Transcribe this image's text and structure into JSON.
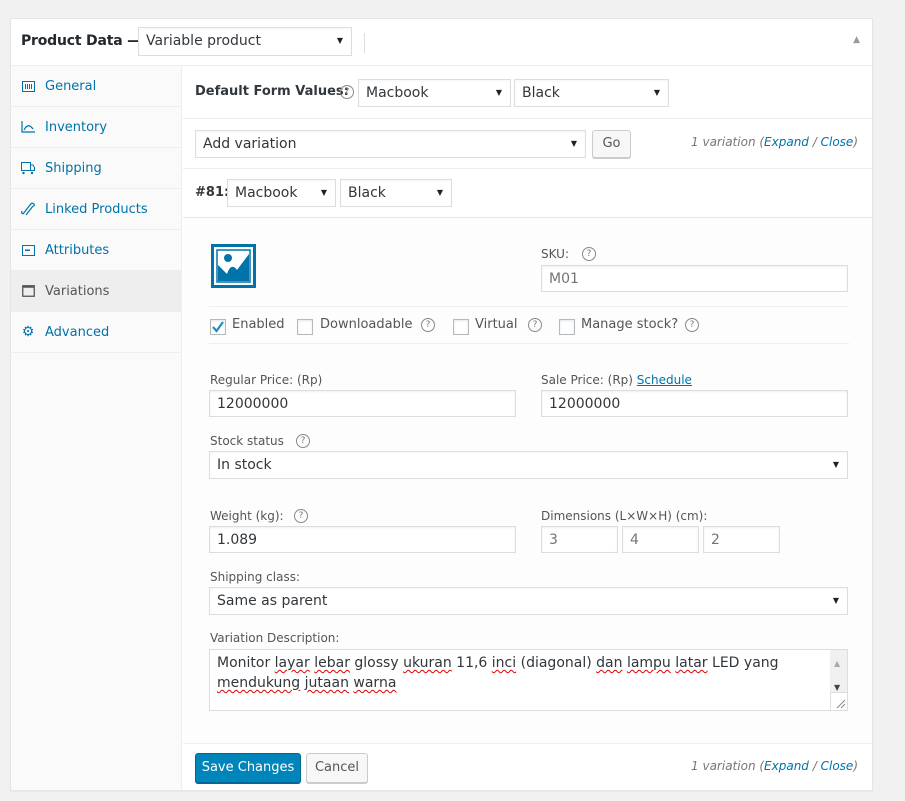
{
  "header": {
    "title": "Product Data —",
    "product_type": "Variable product",
    "collapse_icon": "triangle-up-icon"
  },
  "tabs": [
    {
      "label": "General",
      "icon": "barcode-icon",
      "active": false
    },
    {
      "label": "Inventory",
      "icon": "chart-icon",
      "active": false
    },
    {
      "label": "Shipping",
      "icon": "truck-icon",
      "active": false
    },
    {
      "label": "Linked Products",
      "icon": "link-icon",
      "active": false
    },
    {
      "label": "Attributes",
      "icon": "list-icon",
      "active": false
    },
    {
      "label": "Variations",
      "icon": "window-icon",
      "active": true
    },
    {
      "label": "Advanced",
      "icon": "gear-icon",
      "active": false
    }
  ],
  "default_form": {
    "label": "Default Form Values:",
    "help": "?",
    "attr1": "Macbook",
    "attr2": "Black"
  },
  "add_variation": {
    "select": "Add variation",
    "go_label": "Go",
    "count_text": "1 variation",
    "expand": "Expand",
    "slash": " / ",
    "close": "Close"
  },
  "variation": {
    "id_label": "#81:",
    "attr1": "Macbook",
    "attr2": "Black",
    "image_icon": "image-placeholder-icon",
    "sku": {
      "label": "SKU:",
      "placeholder": "M01",
      "value": ""
    },
    "checkboxes": [
      {
        "label": "Enabled",
        "checked": true,
        "help": false
      },
      {
        "label": "Downloadable",
        "checked": false,
        "help": true
      },
      {
        "label": "Virtual",
        "checked": false,
        "help": true
      },
      {
        "label": "Manage stock?",
        "checked": false,
        "help": true
      }
    ],
    "regular_price": {
      "label": "Regular Price: (Rp)",
      "value": "12000000"
    },
    "sale_price": {
      "label": "Sale Price: (Rp)",
      "link": "Schedule",
      "value": "12000000"
    },
    "stock_status": {
      "label": "Stock status",
      "value": "In stock"
    },
    "weight": {
      "label": "Weight (kg):",
      "value": "1.089"
    },
    "dimensions": {
      "label": "Dimensions (L×W×H) (cm):",
      "length_placeholder": "3",
      "width_placeholder": "4",
      "height_placeholder": "2"
    },
    "shipping_class": {
      "label": "Shipping class:",
      "value": "Same as parent"
    },
    "description": {
      "label": "Variation Description:",
      "value": "Monitor layar lebar glossy ukuran 11,6 inci (diagonal) dan lampu latar LED yang mendukung jutaan warna"
    }
  },
  "footer": {
    "save_label": "Save Changes",
    "cancel_label": "Cancel",
    "count_text": "1 variation",
    "expand": "Expand",
    "slash": " / ",
    "close": "Close"
  },
  "colors": {
    "accent": "#0073aa",
    "primary_button": "#0085ba"
  }
}
